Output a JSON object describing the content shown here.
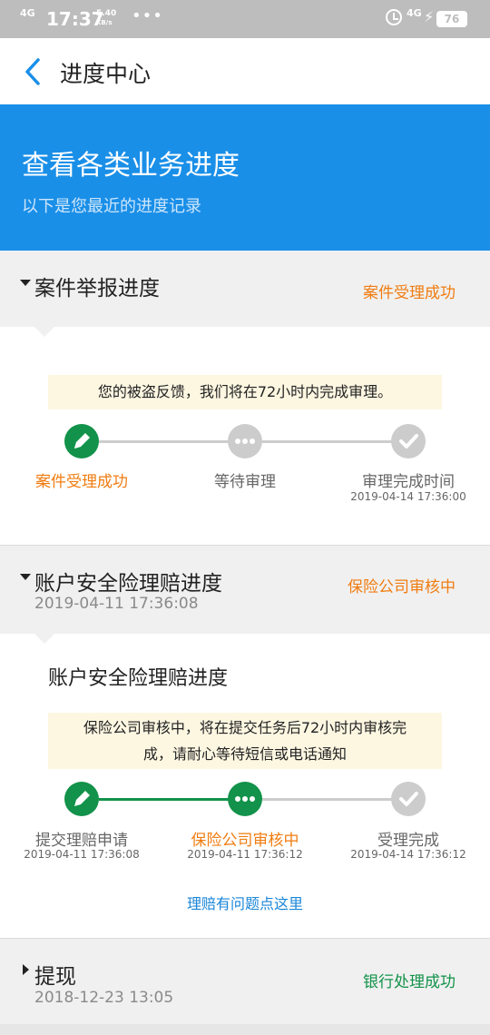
{
  "status_bar": {
    "signal": "4G",
    "time": "17:37",
    "speed_value": "5.40",
    "speed_unit": "KB/s",
    "dots": "•••",
    "signal_right": "4G",
    "battery": "76"
  },
  "nav": {
    "back_icon": "chevron-left-icon",
    "title": "进度中心"
  },
  "hero": {
    "title": "查看各类业务进度",
    "subtitle": "以下是您最近的进度记录"
  },
  "colors": {
    "brand_blue": "#1a8fe8",
    "orange": "#f07c10",
    "green": "#12924a",
    "grey_step": "#cccccc"
  },
  "sections": [
    {
      "name": "案件举报进度",
      "status": "案件受理成功",
      "notice": "您的被盗反馈，我们将在72小时内完成审理。",
      "steps": [
        {
          "label": "案件受理成功",
          "time": "",
          "state": "done",
          "icon": "pencil-icon"
        },
        {
          "label": "等待审理",
          "time": "",
          "state": "pending",
          "icon": "more-dots-icon"
        },
        {
          "label": "审理完成时间",
          "time": "2019-04-14 17:36:00",
          "state": "pending",
          "icon": "check-icon"
        }
      ]
    },
    {
      "name": "账户安全险理赔进度",
      "date": "2019-04-11 17:36:08",
      "status": "保险公司审核中",
      "sub_title": "账户安全险理赔进度",
      "notice_line1": "保险公司审核中，将在提交任务后72小时内审核完",
      "notice_line2": "成，请耐心等待短信或电话通知",
      "steps": [
        {
          "label": "提交理赔申请",
          "time": "2019-04-11 17:36:08",
          "state": "done",
          "icon": "pencil-icon"
        },
        {
          "label": "保险公司审核中",
          "time": "2019-04-11 17:36:12",
          "state": "current",
          "icon": "more-dots-icon"
        },
        {
          "label": "受理完成",
          "time": "2019-04-14 17:36:12",
          "state": "pending",
          "icon": "check-icon"
        }
      ],
      "help_link": "理赔有问题点这里"
    },
    {
      "name": "提现",
      "date": "2018-12-23 13:05",
      "status": "银行处理成功"
    }
  ]
}
